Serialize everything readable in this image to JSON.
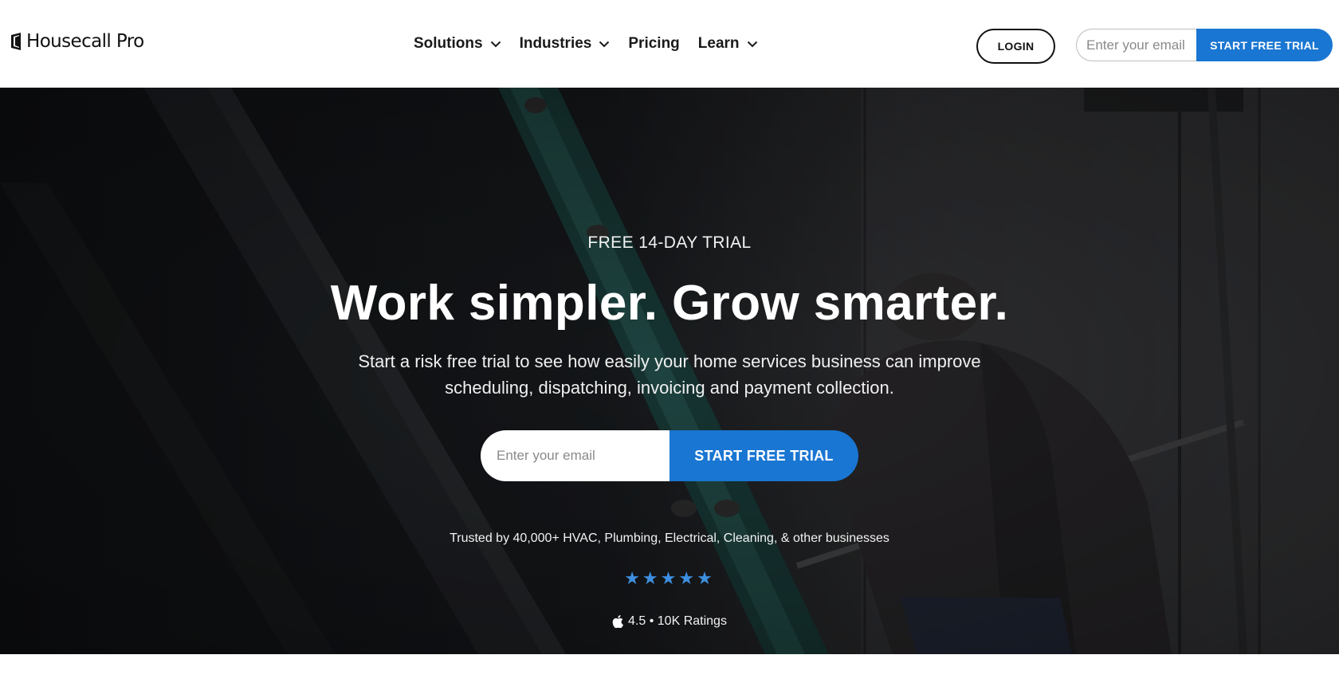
{
  "header": {
    "logo_text": "Housecall Pro",
    "nav": [
      {
        "label": "Solutions",
        "has_dropdown": true
      },
      {
        "label": "Industries",
        "has_dropdown": true
      },
      {
        "label": "Pricing",
        "has_dropdown": false
      },
      {
        "label": "Learn",
        "has_dropdown": true
      }
    ],
    "login_label": "LOGIN",
    "email_placeholder": "Enter your email",
    "trial_label": "START FREE TRIAL"
  },
  "hero": {
    "eyebrow": "FREE 14-DAY TRIAL",
    "headline": "Work simpler. Grow smarter.",
    "subhead": "Start a risk free trial to see how easily your home services business can improve scheduling, dispatching, invoicing and payment collection.",
    "email_placeholder": "Enter your email",
    "trial_label": "START FREE TRIAL",
    "trusted_text": "Trusted by 40,000+ HVAC, Plumbing, Electrical, Cleaning, & other businesses",
    "stars": "★★★★★",
    "rating_text": "4.5 • 10K Ratings"
  },
  "colors": {
    "brand_blue": "#1976d2",
    "star_blue": "#3d8fe0"
  },
  "icons": [
    "housecall-logo-icon",
    "chevron-down-icon",
    "star-icon",
    "apple-icon"
  ]
}
